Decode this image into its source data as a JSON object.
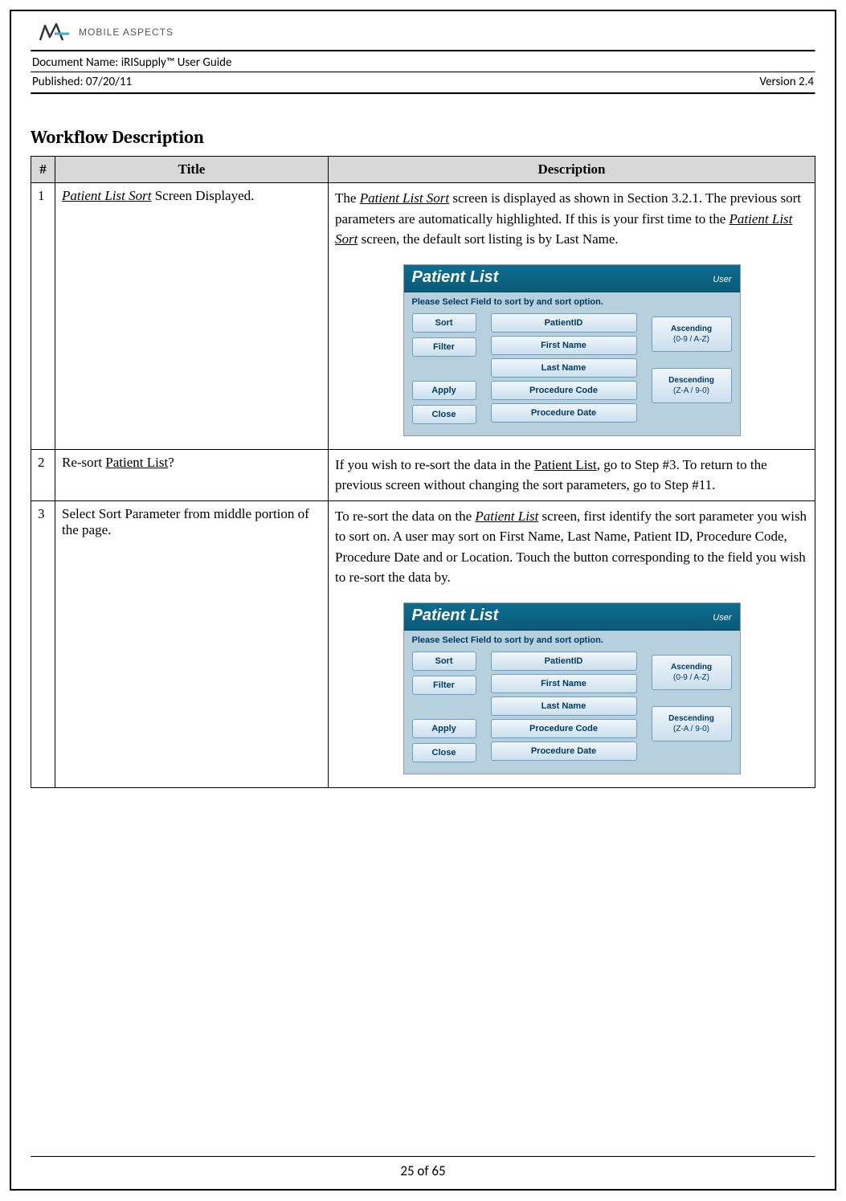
{
  "header": {
    "brand": "MOBILE ASPECTS",
    "doc_name_label": "Document Name:",
    "doc_name": "iRISupply™ User Guide",
    "published_label": "Published:",
    "published": "07/20/11",
    "version": "Version 2.4"
  },
  "section": {
    "title": "Workflow Description"
  },
  "table": {
    "headers": {
      "num": "#",
      "title": "Title",
      "desc": "Description"
    },
    "rows": [
      {
        "num": "1",
        "title_pre": "",
        "title_ul": "Patient List Sort",
        "title_post": " Screen Displayed.",
        "desc_segments": [
          {
            "t": "The "
          },
          {
            "t": "Patient List Sort",
            "style": "ul-ital"
          },
          {
            "t": " screen is displayed as shown in Section 3.2.1.  The previous sort parameters are automatically highlighted.  If this is your first time to the "
          },
          {
            "t": "Patient List Sort",
            "style": "ul-ital"
          },
          {
            "t": " screen, the default sort listing is by Last Name."
          }
        ],
        "has_screenshot": true
      },
      {
        "num": "2",
        "title_pre": "Re-sort ",
        "title_ul": "Patient List",
        "title_ul_style": "ul",
        "title_post": "?",
        "desc_segments": [
          {
            "t": "If you wish to re-sort the data in the "
          },
          {
            "t": "Patient List",
            "style": "ul"
          },
          {
            "t": ", go to Step #3.  To return to the previous screen without changing the sort parameters, go to Step #11."
          }
        ],
        "has_screenshot": false
      },
      {
        "num": "3",
        "title_plain": "Select Sort Parameter from middle portion of the page.",
        "desc_segments": [
          {
            "t": "To re-sort the data on the "
          },
          {
            "t": "Patient List",
            "style": "ul-ital"
          },
          {
            "t": " screen, first identify the sort parameter you wish to sort on.  A user may sort on First Name, Last Name, Patient ID, Procedure Code, Procedure Date and or Location.  Touch the button corresponding to the field you wish to re-sort the data by."
          }
        ],
        "has_screenshot": true
      }
    ]
  },
  "screenshot": {
    "title": "Patient List",
    "user": "User",
    "instruction": "Please Select Field to sort by and sort option.",
    "left": [
      "Sort",
      "Filter",
      "Apply",
      "Close"
    ],
    "mid": [
      "PatientID",
      "First Name",
      "Last Name",
      "Procedure Code",
      "Procedure Date"
    ],
    "right": [
      {
        "label": "Ascending",
        "sub": "(0-9 / A-Z)"
      },
      {
        "label": "Descending",
        "sub": "(Z-A / 9-0)"
      }
    ]
  },
  "footer": {
    "page": "25 of 65"
  }
}
